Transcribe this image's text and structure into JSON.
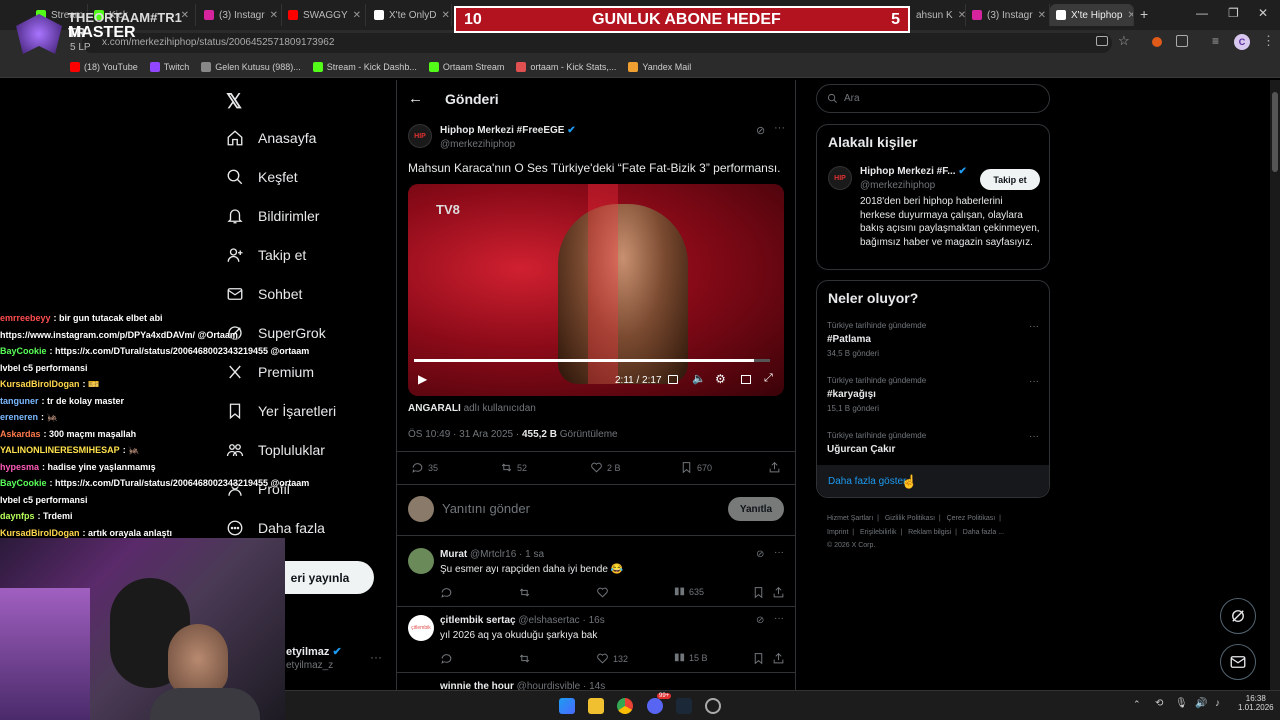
{
  "browser": {
    "tabs": [
      {
        "label": "Stream",
        "color": "#53fc18"
      },
      {
        "label": "Kick",
        "color": "#53fc18"
      },
      {
        "label": "(3) Instagr",
        "color": "#d6249f"
      },
      {
        "label": "SWAGGY",
        "color": "#ff0000"
      },
      {
        "label": "X'te OnlyD",
        "color": "#ffffff"
      },
      {
        "label": "ahsun K",
        "color": "#ffffff"
      },
      {
        "label": "(3) Instagr",
        "color": "#d6249f"
      },
      {
        "label": "X'te Hiphop",
        "color": "#ffffff"
      }
    ],
    "url": "x.com/merkezihiphop/status/2006452571809173962",
    "bookmarks": [
      {
        "label": "(18) YouTube",
        "color": "#ff0000"
      },
      {
        "label": "Twitch",
        "color": "#9146ff"
      },
      {
        "label": "Gelen Kutusu (988)...",
        "color": "#888888"
      },
      {
        "label": "Stream - Kick Dashb...",
        "color": "#53fc18"
      },
      {
        "label": "Ortaam Stream",
        "color": "#53fc18"
      },
      {
        "label": "ortaam - Kick Stats,...",
        "color": "#e05050"
      },
      {
        "label": "Yandex Mail",
        "color": "#f0a030"
      }
    ]
  },
  "overlay": {
    "banner_left": "10",
    "banner_title": "GUNLUK ABONE HEDEF",
    "banner_right": "5",
    "streamer_name": "THEORTAAM#TR1 TR",
    "rank": "MASTER",
    "lp": "5 LP"
  },
  "nav": {
    "items": [
      {
        "label": "Anasayfa",
        "icon": "home-icon"
      },
      {
        "label": "Keşfet",
        "icon": "search-icon"
      },
      {
        "label": "Bildirimler",
        "icon": "bell-icon"
      },
      {
        "label": "Takip et",
        "icon": "person-add-icon"
      },
      {
        "label": "Sohbet",
        "icon": "mail-icon"
      },
      {
        "label": "SuperGrok",
        "icon": "grok-icon"
      },
      {
        "label": "Premium",
        "icon": "x-icon"
      },
      {
        "label": "Yer İşaretleri",
        "icon": "bookmark-icon"
      },
      {
        "label": "Topluluklar",
        "icon": "people-icon"
      },
      {
        "label": "Profil",
        "icon": "profile-icon"
      },
      {
        "label": "Daha fazla",
        "icon": "more-icon"
      }
    ],
    "post_button": "eri yayınla",
    "account_name": "etyilmaz",
    "account_handle": "etyilmaz_z"
  },
  "post": {
    "header": "Gönderi",
    "author": "Hiphop Merkezi #FreeEGE",
    "handle": "@merkezihiphop",
    "text": "Mahsun Karaca'nın O Ses Türkiye'deki “Fate Fat-Bizik 3” performansı.",
    "video_time": "2:11 / 2:17",
    "video_channel": "TV8",
    "caption_user": "ANGARALI",
    "caption_suffix": "adlı kullanıcıdan",
    "timestamp": "ÖS 10:49 · 31 Ara 2025 ·",
    "views": "455,2 B",
    "views_label": "Görüntüleme",
    "replies": "35",
    "reposts": "52",
    "likes": "2 B",
    "bookmarks": "670",
    "video_progress": 0.955
  },
  "reply_box": {
    "placeholder": "Yanıtını gönder",
    "button": "Yanıtla"
  },
  "replies": [
    {
      "author": "Murat",
      "handle": "@Mrtclr16 · 1 sa",
      "text": "Şu esmer ayı rapçiden daha iyi bende 😂",
      "reply_count": "",
      "repost_count": "",
      "like_count": "",
      "views": "635",
      "avatar_color": "#6a8a5a"
    },
    {
      "author": "çitlembik sertaç",
      "handle": "@elshasertac · 16s",
      "text": "yıl 2026 aq ya okuduğu şarkıya bak",
      "reply_count": "",
      "repost_count": "",
      "like_count": "132",
      "views": "15 B",
      "avatar_color": "#ffffff"
    },
    {
      "author": "winnie the hour",
      "handle": "@hourdisvible · 14s",
      "text": "",
      "reply_count": "",
      "repost_count": "",
      "like_count": "",
      "views": "",
      "avatar_color": "#888888"
    }
  ],
  "search": {
    "placeholder": "Ara"
  },
  "related": {
    "title": "Alakalı kişiler",
    "name": "Hiphop Merkezi #F...",
    "handle": "@merkezihiphop",
    "follow_button": "Takip et",
    "bio": "2018'den beri hiphop haberlerini herkese duyurmaya çalışan, olaylara bakış açısını paylaşmaktan çekinmeyen, bağımsız haber ve magazin sayfasıyız."
  },
  "trends": {
    "title": "Neler oluyor?",
    "items": [
      {
        "context": "Türkiye tarihinde gündemde",
        "name": "#Patlama",
        "count": "34,5 B gönderi"
      },
      {
        "context": "Türkiye tarihinde gündemde",
        "name": "#karyağışı",
        "count": "15,1 B gönderi"
      },
      {
        "context": "Türkiye tarihinde gündemde",
        "name": "Uğurcan Çakır",
        "count": ""
      }
    ],
    "show_more": "Daha fazla göster"
  },
  "footer": {
    "links": [
      "Hizmet Şartları",
      "Gizlilik Politikası",
      "Çerez Politikası",
      "Imprint",
      "Erişilebilirlik",
      "Reklam bilgisi",
      "Daha fazla ..."
    ],
    "copyright": "© 2026 X Corp."
  },
  "chat": [
    {
      "user": "emrreebeyy",
      "user_color": "#ff4d4d",
      "msg": ": bir gun tutacak elbet abi",
      "cont": "https://www.instagram.com/p/DPYa4xdDAVm/ @Ortaam"
    },
    {
      "user": "BayCookie",
      "user_color": "#5aff5a",
      "msg": ": https://x.com/DTural/status/2006468002343219455 @ortaam",
      "cont": "lvbel c5 performansi"
    },
    {
      "user": "KursadBirolDogan",
      "user_color": "#ffd84d",
      "msg": ": 🎫",
      "cont": ""
    },
    {
      "user": "tanguner",
      "user_color": "#7ab8ff",
      "msg": ": tr de kolay master",
      "cont": ""
    },
    {
      "user": "ereneren",
      "user_color": "#7ab8ff",
      "msg": ": 🦗",
      "cont": ""
    },
    {
      "user": "Askardas",
      "user_color": "#ff7a4d",
      "msg": ": 300 maçmı maşallah",
      "cont": ""
    },
    {
      "user": "YALINONLINERESMIHESAP",
      "user_color": "#ffe14d",
      "msg": ": 🦗",
      "cont": ""
    },
    {
      "user": "hypesma",
      "user_color": "#ff5ab8",
      "msg": ": hadise yine yaşlanmamış",
      "cont": ""
    },
    {
      "user": "BayCookie",
      "user_color": "#5aff5a",
      "msg": ": https://x.com/DTural/status/2006468002343219455 @ortaam",
      "cont": "lvbel c5 performansi"
    },
    {
      "user": "daynfps",
      "user_color": "#b8ff5a",
      "msg": ": Trdemi",
      "cont": ""
    },
    {
      "user": "KursadBirolDogan",
      "user_color": "#ffd84d",
      "msg": ": artık orayala anlaştı",
      "cont": ""
    }
  ],
  "taskbar": {
    "time": "16:38",
    "date": "1.01.2026",
    "notif_count": "99+"
  }
}
